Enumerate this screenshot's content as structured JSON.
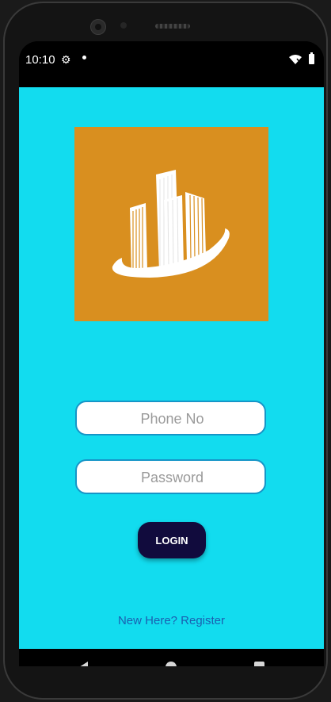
{
  "status_bar": {
    "time": "10:10",
    "icons": [
      "gear-icon",
      "notification-dot-icon",
      "wifi-icon",
      "battery-icon"
    ]
  },
  "app": {
    "background_color": "#12dcef",
    "logo": {
      "icon": "city-buildings-logo-icon",
      "background_color": "#d98f1f"
    },
    "phone_field": {
      "placeholder": "Phone No",
      "value": ""
    },
    "password_field": {
      "placeholder": "Password",
      "value": ""
    },
    "login_button": {
      "label": "LOGIN",
      "color": "#110b3d"
    },
    "register_link": {
      "label": "New Here? Register",
      "color": "#1b5fb0"
    }
  },
  "nav_bar": {
    "icons": [
      "back-icon",
      "home-icon",
      "recents-icon"
    ]
  }
}
